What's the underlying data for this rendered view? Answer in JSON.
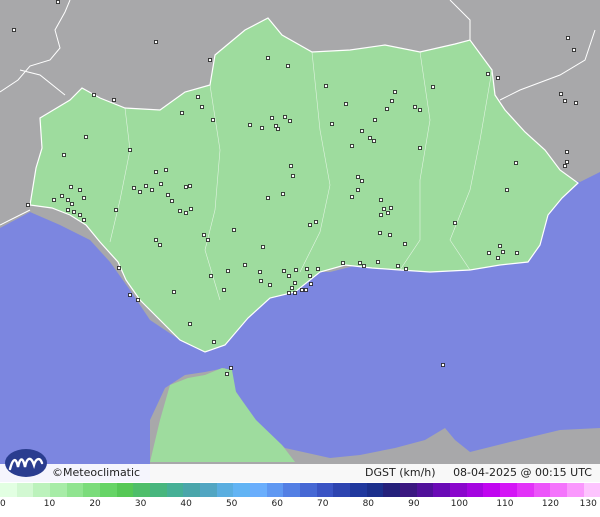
{
  "map": {
    "credit": "©Meteoclimatic",
    "variable_label": "DGST (km/h)",
    "timestamp": "08-04-2025 @ 00:15 UTC",
    "colors": {
      "sea": "#7c86e0",
      "land_outside": "#a8a8aa",
      "region_fill": "#9edc9e",
      "region_border": "#ffffff",
      "station_marker": "#1a1a1a"
    }
  },
  "scale": {
    "ticks": [
      "0",
      "10",
      "20",
      "30",
      "40",
      "50",
      "60",
      "70",
      "80",
      "90",
      "100",
      "110",
      "120",
      "130"
    ],
    "colors": [
      "#e2ffe2",
      "#d2f8d2",
      "#bcf2bc",
      "#a7eca7",
      "#90e490",
      "#7bdc7b",
      "#66d466",
      "#56c856",
      "#4fbe6a",
      "#48b67e",
      "#46b096",
      "#4aa6aa",
      "#52a6c2",
      "#5aaee0",
      "#62b4f4",
      "#6aaefc",
      "#5f98f2",
      "#537fe4",
      "#4668d4",
      "#3a54c4",
      "#2d44b0",
      "#20389e",
      "#1b2f8c",
      "#24207a",
      "#3a1780",
      "#50109a",
      "#6a0ab6",
      "#8a06cc",
      "#a404e0",
      "#c004f0",
      "#d416f6",
      "#e232f8",
      "#ec54fa",
      "#f474fc",
      "#fa98fd",
      "#fdc4fe"
    ]
  }
}
